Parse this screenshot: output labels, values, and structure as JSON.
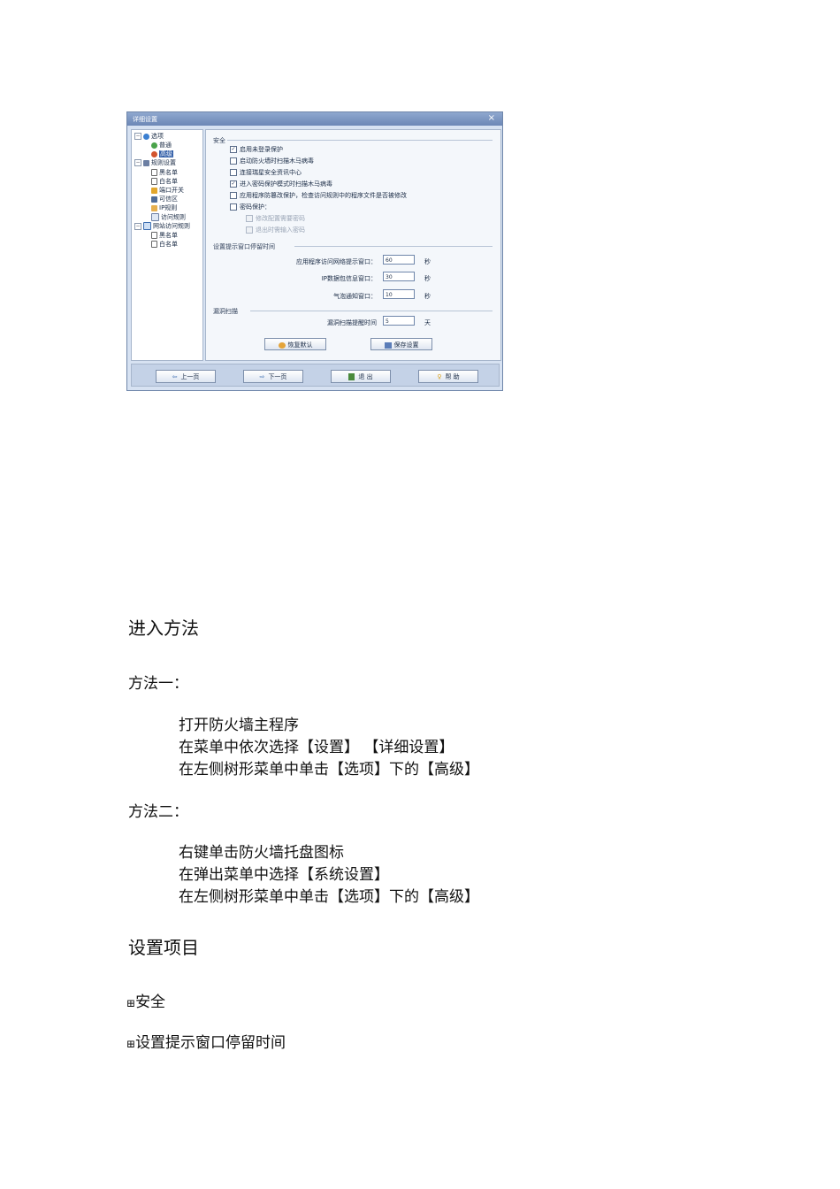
{
  "dialog": {
    "title": "详细设置",
    "close_glyph": "×",
    "tree": {
      "options": "选项",
      "general": "普通",
      "advanced": "高级",
      "rules": "规则设置",
      "blacklist": "黑名单",
      "whitelist": "白名单",
      "ports": "端口开关",
      "trusted_zone": "可信区",
      "ip_rules": "IP规则",
      "access_rules": "访问规则",
      "web_rules": "网站访问规则",
      "web_blacklist": "黑名单",
      "web_whitelist": "白名单"
    },
    "security": {
      "title": "安全",
      "opt1": "启用未登录保护",
      "opt2": "启动防火墙时扫描木马病毒",
      "opt3": "连接瑞星安全资讯中心",
      "opt4": "进入密码保护模式时扫描木马病毒",
      "opt5": "应用程序防篡改保护，检查访问规则中的程序文件是否被修改",
      "opt6": "密码保护：",
      "sub1": "修改配置需要密码",
      "sub2": "退出时需输入密码",
      "checked": [
        true,
        false,
        false,
        true,
        false,
        false
      ]
    },
    "popup": {
      "title": "设置提示窗口停留时间",
      "app_label": "应用程序访问网络提示窗口：",
      "app_value": "60",
      "ip_label": "IP数据包信息窗口：",
      "ip_value": "30",
      "bubble_label": "气泡通知窗口：",
      "bubble_value": "10",
      "unit": "秒"
    },
    "scan": {
      "title": "漏洞扫描",
      "label": "漏洞扫描提醒时间",
      "value": "5",
      "unit": "天"
    },
    "restore_label": "恢复默认",
    "save_label": "保存设置",
    "nav": {
      "prev": "上一页",
      "next": "下一页",
      "exit": "退 出",
      "help": "帮 助"
    }
  },
  "document": {
    "heading1": "进入方法",
    "method1_title": "方法一：",
    "method1_steps": [
      "打开防火墙主程序",
      "在菜单中依次选择【设置】 【详细设置】",
      "在左侧树形菜单中单击【选项】下的【高级】"
    ],
    "method2_title": "方法二：",
    "method2_steps": [
      "右键单击防火墙托盘图标",
      "在弹出菜单中选择【系统设置】",
      "在左侧树形菜单中单击【选项】下的【高级】"
    ],
    "heading2": "设置项目",
    "expand_glyph": "⊞",
    "item1": "安全",
    "item2": "设置提示窗口停留时间"
  }
}
